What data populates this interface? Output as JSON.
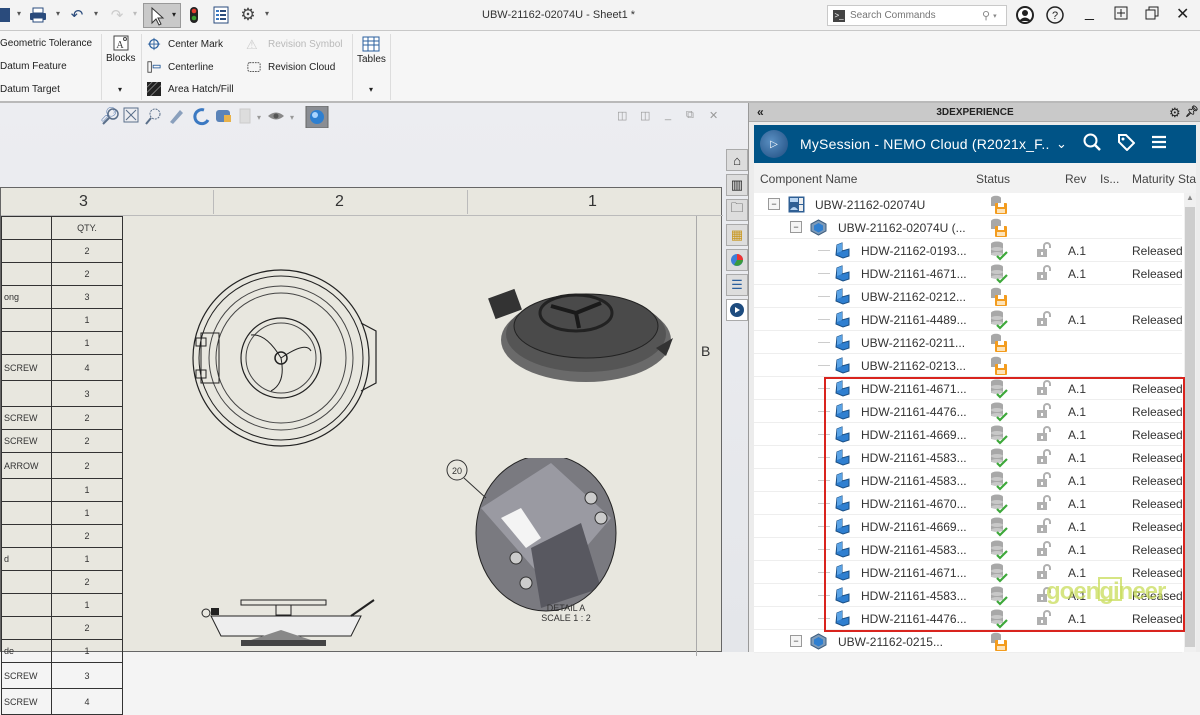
{
  "titlebar": {
    "document_title": "UBW-21162-02074U - Sheet1 *",
    "search": {
      "placeholder": "Search Commands",
      "value": ""
    },
    "toolbar_icons": [
      "save-icon",
      "print-icon",
      "undo-icon",
      "redo-icon",
      "select-arrow-icon",
      "traffic-light-icon",
      "file-properties-icon",
      "options-gear-icon"
    ],
    "window_icons": [
      "user-icon",
      "help-icon",
      "minimize-icon",
      "tile-icon",
      "restore-icon",
      "close-icon"
    ]
  },
  "ribbon": {
    "col1": [
      "Geometric Tolerance",
      "Datum Feature",
      "Datum Target"
    ],
    "blocks": "Blocks",
    "col3": [
      "Center Mark",
      "Centerline",
      "Area Hatch/Fill"
    ],
    "col4": [
      "Revision Symbol",
      "Revision Cloud"
    ],
    "tables": "Tables"
  },
  "drawing": {
    "zones": [
      "3",
      "2",
      "1"
    ],
    "zone_row_label": "B",
    "bom_header": "QTY.",
    "bom_rows": [
      {
        "desc": "",
        "qty": "2"
      },
      {
        "desc": "",
        "qty": "2"
      },
      {
        "desc": "ong",
        "qty": "3"
      },
      {
        "desc": "",
        "qty": "1"
      },
      {
        "desc": "",
        "qty": "1"
      },
      {
        "desc": "SCREW",
        "qty": "4"
      },
      {
        "desc": "",
        "qty": "3"
      },
      {
        "desc": "SCREW",
        "qty": "2"
      },
      {
        "desc": "SCREW",
        "qty": "2"
      },
      {
        "desc": "ARROW",
        "qty": "2"
      },
      {
        "desc": "",
        "qty": "1"
      },
      {
        "desc": "",
        "qty": "1"
      },
      {
        "desc": "",
        "qty": "2"
      },
      {
        "desc": "d",
        "qty": "1"
      },
      {
        "desc": "",
        "qty": "2"
      },
      {
        "desc": "",
        "qty": "1"
      },
      {
        "desc": "",
        "qty": "2"
      },
      {
        "desc": "de",
        "qty": "1"
      },
      {
        "desc": "SCREW",
        "qty": "3"
      },
      {
        "desc": "SCREW",
        "qty": "4"
      }
    ],
    "balloon": "20",
    "detail_label": "DETAIL A",
    "detail_scale": "SCALE 1 : 2"
  },
  "panel": {
    "title": "3DEXPERIENCE",
    "session_name": "MySession - NEMO Cloud (R2021x_F...",
    "columns": {
      "name": "Component Name",
      "status": "Status",
      "rev": "Rev",
      "is": "Is...",
      "maturity": "Maturity Sta"
    },
    "side_tabs": [
      "home-icon",
      "library-icon",
      "folder-icon",
      "appearance-icon",
      "scenes-icon",
      "properties-list-icon",
      "3dexperience-icon"
    ],
    "rows": [
      {
        "level": 0,
        "expand": "−",
        "type": "drawing",
        "name": "UBW-21162-02074U",
        "status": "local-save",
        "lock": false,
        "rev": "",
        "maturity": ""
      },
      {
        "level": 1,
        "expand": "−",
        "type": "assembly",
        "name": "UBW-21162-02074U (...",
        "status": "local-save",
        "lock": false,
        "rev": "",
        "maturity": ""
      },
      {
        "level": 2,
        "expand": "",
        "type": "part",
        "name": "HDW-21162-0193...",
        "status": "saved-ok",
        "lock": true,
        "rev": "A.1",
        "maturity": "Released"
      },
      {
        "level": 2,
        "expand": "",
        "type": "part",
        "name": "HDW-21161-4671...",
        "status": "saved-ok",
        "lock": true,
        "rev": "A.1",
        "maturity": "Released"
      },
      {
        "level": 2,
        "expand": "",
        "type": "part",
        "name": "UBW-21162-0212...",
        "status": "local-save",
        "lock": false,
        "rev": "",
        "maturity": ""
      },
      {
        "level": 2,
        "expand": "",
        "type": "part",
        "name": "HDW-21161-4489...",
        "status": "saved-ok",
        "lock": true,
        "rev": "A.1",
        "maturity": "Released"
      },
      {
        "level": 2,
        "expand": "",
        "type": "part",
        "name": "UBW-21162-0211...",
        "status": "local-save",
        "lock": false,
        "rev": "",
        "maturity": ""
      },
      {
        "level": 2,
        "expand": "",
        "type": "part",
        "name": "UBW-21162-0213...",
        "status": "local-save",
        "lock": false,
        "rev": "",
        "maturity": ""
      },
      {
        "level": 2,
        "expand": "",
        "type": "part",
        "name": "HDW-21161-4671...",
        "status": "saved-ok",
        "lock": true,
        "rev": "A.1",
        "maturity": "Released"
      },
      {
        "level": 2,
        "expand": "",
        "type": "part",
        "name": "HDW-21161-4476...",
        "status": "saved-ok",
        "lock": true,
        "rev": "A.1",
        "maturity": "Released"
      },
      {
        "level": 2,
        "expand": "",
        "type": "part",
        "name": "HDW-21161-4669...",
        "status": "saved-ok",
        "lock": true,
        "rev": "A.1",
        "maturity": "Released"
      },
      {
        "level": 2,
        "expand": "",
        "type": "part",
        "name": "HDW-21161-4583...",
        "status": "saved-ok",
        "lock": true,
        "rev": "A.1",
        "maturity": "Released"
      },
      {
        "level": 2,
        "expand": "",
        "type": "part",
        "name": "HDW-21161-4583...",
        "status": "saved-ok",
        "lock": true,
        "rev": "A.1",
        "maturity": "Released"
      },
      {
        "level": 2,
        "expand": "",
        "type": "part",
        "name": "HDW-21161-4670...",
        "status": "saved-ok",
        "lock": true,
        "rev": "A.1",
        "maturity": "Released"
      },
      {
        "level": 2,
        "expand": "",
        "type": "part",
        "name": "HDW-21161-4669...",
        "status": "saved-ok",
        "lock": true,
        "rev": "A.1",
        "maturity": "Released"
      },
      {
        "level": 2,
        "expand": "",
        "type": "part",
        "name": "HDW-21161-4583...",
        "status": "saved-ok",
        "lock": true,
        "rev": "A.1",
        "maturity": "Released"
      },
      {
        "level": 2,
        "expand": "",
        "type": "part",
        "name": "HDW-21161-4671...",
        "status": "saved-ok",
        "lock": true,
        "rev": "A.1",
        "maturity": "Released"
      },
      {
        "level": 2,
        "expand": "",
        "type": "part",
        "name": "HDW-21161-4583...",
        "status": "saved-ok",
        "lock": true,
        "rev": "A.1",
        "maturity": "Released"
      },
      {
        "level": 2,
        "expand": "",
        "type": "part",
        "name": "HDW-21161-4476...",
        "status": "saved-ok",
        "lock": true,
        "rev": "A.1",
        "maturity": "Released"
      },
      {
        "level": 1,
        "expand": "−",
        "type": "assembly",
        "name": "UBW-21162-0215...",
        "status": "local-save",
        "lock": false,
        "rev": "",
        "maturity": ""
      }
    ]
  },
  "watermark": "goengineer",
  "colors": {
    "session_bar": "#005386",
    "highlight": "#d9241e",
    "ok_check": "#3da83a",
    "save_orange": "#f39c1e"
  }
}
